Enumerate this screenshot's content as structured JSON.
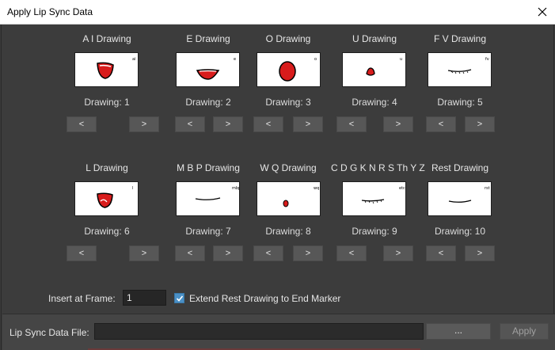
{
  "window": {
    "title": "Apply Lip Sync Data"
  },
  "row1": [
    {
      "label": "A I Drawing",
      "drawing": "Drawing: 1",
      "prev": "<",
      "next": ">",
      "mouth": "open-red"
    },
    {
      "label": "E Drawing",
      "drawing": "Drawing: 2",
      "prev": "<",
      "next": ">",
      "mouth": "wide-red"
    },
    {
      "label": "O Drawing",
      "drawing": "Drawing: 3",
      "prev": "<",
      "next": ">",
      "mouth": "round-red"
    },
    {
      "label": "U Drawing",
      "drawing": "Drawing: 4",
      "prev": "<",
      "next": ">",
      "mouth": "small-red"
    },
    {
      "label": "F V Drawing",
      "drawing": "Drawing: 5",
      "prev": "<",
      "next": ">",
      "mouth": "teeth-line"
    }
  ],
  "row2": [
    {
      "label": "L Drawing",
      "drawing": "Drawing: 6",
      "prev": "<",
      "next": ">",
      "mouth": "tongue-red"
    },
    {
      "label": "M B P Drawing",
      "drawing": "Drawing: 7",
      "prev": "<",
      "next": ">",
      "mouth": "closed-line"
    },
    {
      "label": "W Q Drawing",
      "drawing": "Drawing: 8",
      "prev": "<",
      "next": ">",
      "mouth": "tiny-red"
    },
    {
      "label": "C D G K N R S Th Y Z",
      "drawing": "Drawing: 9",
      "prev": "<",
      "next": ">",
      "mouth": "teeth-line"
    },
    {
      "label": "Rest Drawing",
      "drawing": "Drawing: 10",
      "prev": "<",
      "next": ">",
      "mouth": "closed-line"
    }
  ],
  "options": {
    "insert_label": "Insert at Frame:",
    "insert_value": "1",
    "extend_label": "Extend Rest Drawing to End Marker",
    "extend_checked": true
  },
  "footer": {
    "file_label": "Lip Sync Data File:",
    "file_value": "",
    "browse_label": "...",
    "apply_label": "Apply"
  },
  "colors": {
    "accent": "#4a90c6",
    "mouth_red": "#d81c1c",
    "bg": "#3c3c3c"
  }
}
